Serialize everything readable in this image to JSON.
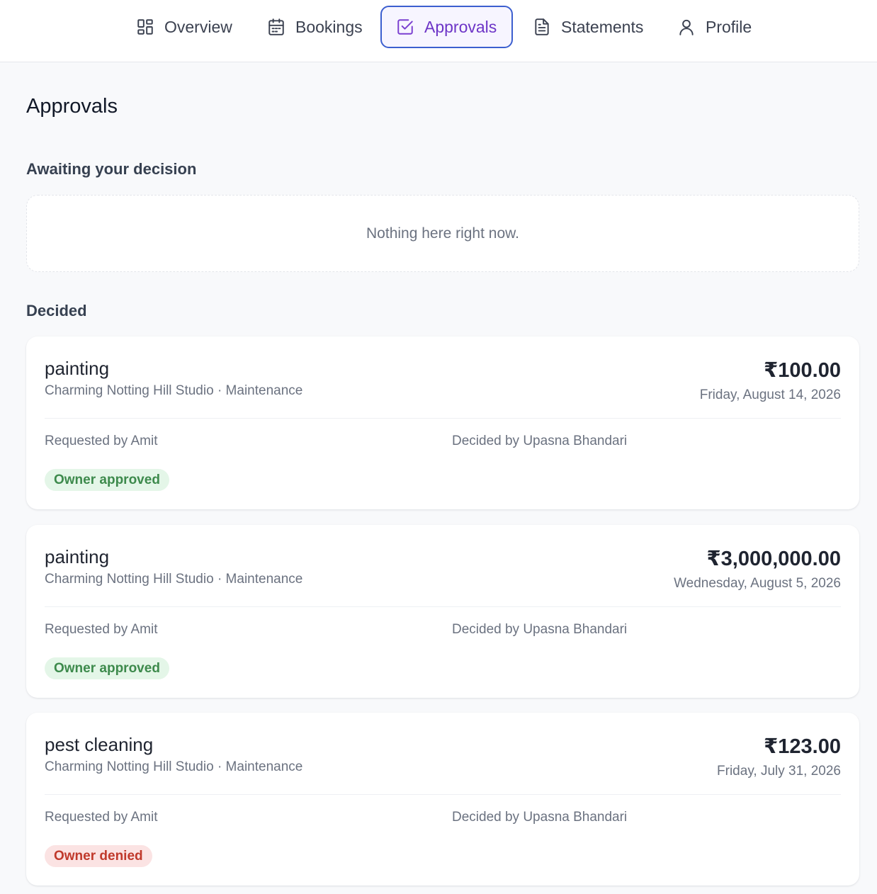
{
  "nav": {
    "tabs": [
      {
        "label": "Overview",
        "icon": "grid-icon"
      },
      {
        "label": "Bookings",
        "icon": "calendar-icon"
      },
      {
        "label": "Approvals",
        "icon": "check-square-icon",
        "active": true
      },
      {
        "label": "Statements",
        "icon": "document-icon"
      },
      {
        "label": "Profile",
        "icon": "user-icon"
      }
    ]
  },
  "page": {
    "title": "Approvals",
    "awaiting_title": "Awaiting your decision",
    "awaiting_empty": "Nothing here right now.",
    "decided_title": "Decided"
  },
  "decided": [
    {
      "title": "painting",
      "subtitle": "Charming Notting Hill Studio · Maintenance",
      "amount": "₹100.00",
      "date": "Friday, August 14, 2026",
      "requested_by": "Requested by Amit",
      "decided_by": "Decided by Upasna Bhandari",
      "status": "Owner approved"
    },
    {
      "title": "painting",
      "subtitle": "Charming Notting Hill Studio · Maintenance",
      "amount": "₹3,000,000.00",
      "date": "Wednesday, August 5, 2026",
      "requested_by": "Requested by Amit",
      "decided_by": "Decided by Upasna Bhandari",
      "status": "Owner approved"
    },
    {
      "title": "pest cleaning",
      "subtitle": "Charming Notting Hill Studio · Maintenance",
      "amount": "₹123.00",
      "date": "Friday, July 31, 2026",
      "requested_by": "Requested by Amit",
      "decided_by": "Decided by Upasna Bhandari",
      "status": "Owner denied"
    }
  ],
  "colors": {
    "active_tab_border": "#3c5fcf",
    "active_tab_text": "#6d35c7",
    "approved_bg": "#e4f6e8",
    "approved_text": "#3d8a4c",
    "denied_bg": "#fbe3e3",
    "denied_text": "#c0392b"
  }
}
